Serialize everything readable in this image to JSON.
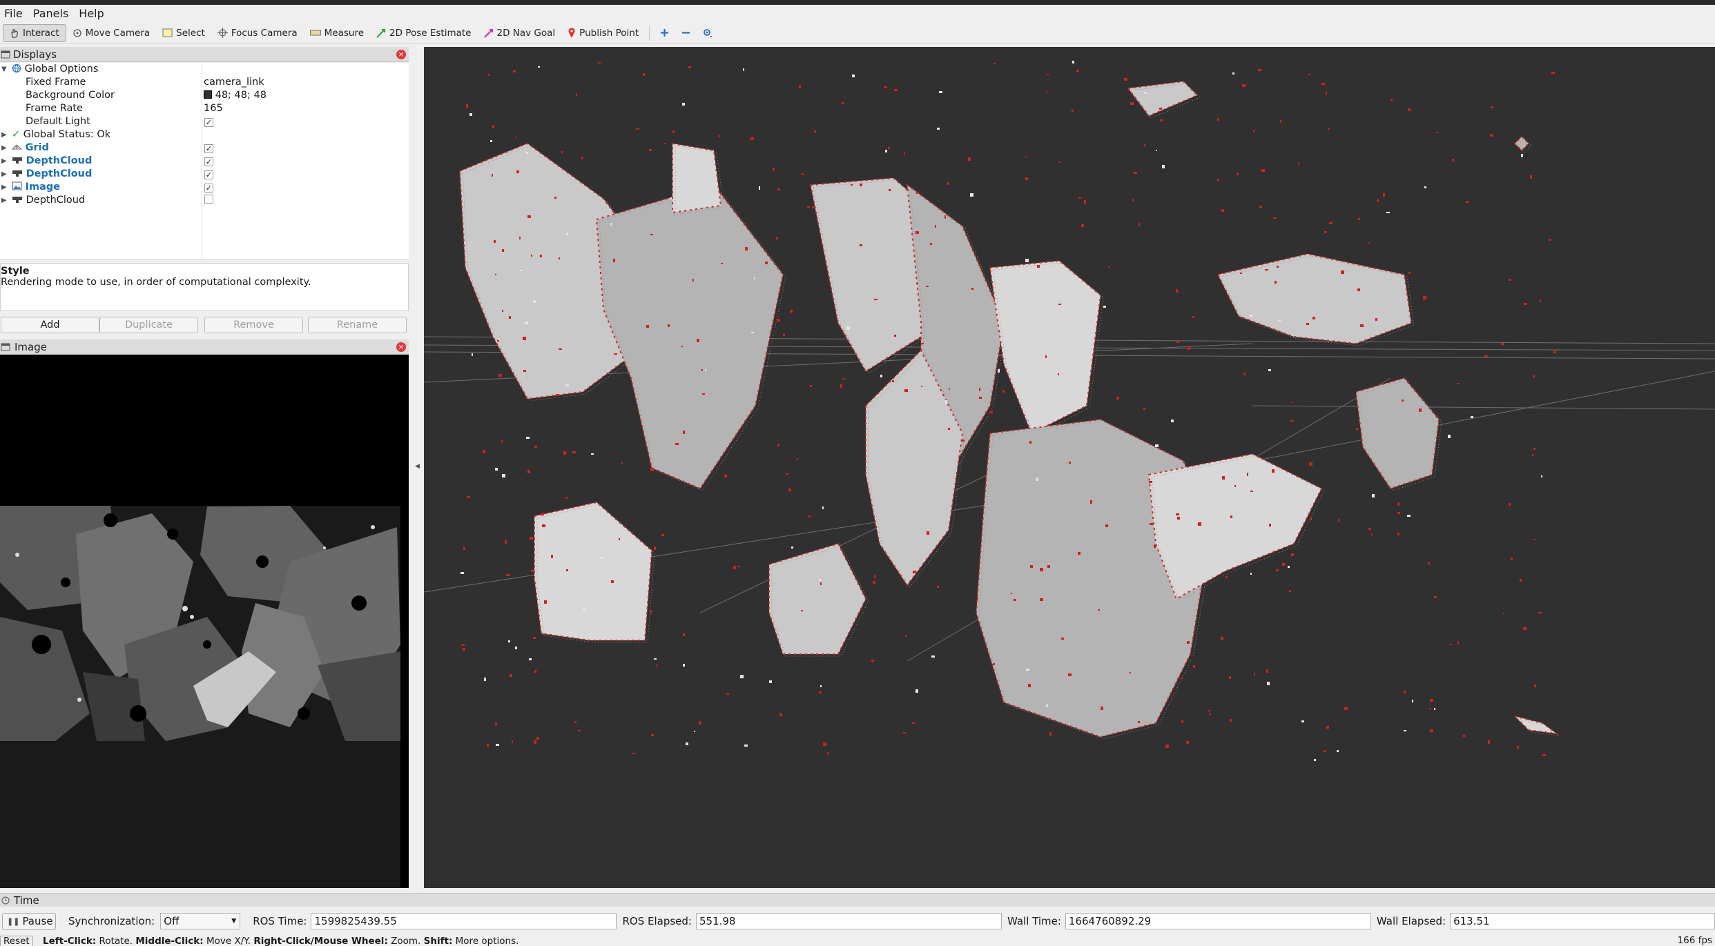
{
  "menu": {
    "file": "File",
    "panels": "Panels",
    "help": "Help"
  },
  "toolbar": {
    "interact": "Interact",
    "move_camera": "Move Camera",
    "select": "Select",
    "focus_camera": "Focus Camera",
    "measure": "Measure",
    "pose_estimate": "2D Pose Estimate",
    "nav_goal": "2D Nav Goal",
    "publish_point": "Publish Point"
  },
  "displays": {
    "title": "Displays",
    "global_options": "Global Options",
    "fixed_frame_label": "Fixed Frame",
    "fixed_frame_value": "camera_link",
    "background_color_label": "Background Color",
    "background_color_value": "48; 48; 48",
    "frame_rate_label": "Frame Rate",
    "frame_rate_value": "165",
    "default_light_label": "Default Light",
    "global_status": "Global Status: Ok",
    "items": [
      {
        "label": "Grid",
        "checked": true
      },
      {
        "label": "DepthCloud",
        "checked": true
      },
      {
        "label": "DepthCloud",
        "checked": true
      },
      {
        "label": "Image",
        "checked": true
      },
      {
        "label": "DepthCloud",
        "checked": false
      }
    ]
  },
  "description": {
    "title": "Style",
    "text": "Rendering mode to use, in order of computational complexity."
  },
  "buttons": {
    "add": "Add",
    "duplicate": "Duplicate",
    "remove": "Remove",
    "rename": "Rename"
  },
  "image_panel": {
    "title": "Image"
  },
  "time": {
    "title": "Time",
    "pause": "Pause",
    "sync_label": "Synchronization:",
    "sync_value": "Off",
    "ros_time_label": "ROS Time:",
    "ros_time": "1599825439.55",
    "ros_elapsed_label": "ROS Elapsed:",
    "ros_elapsed": "551.98",
    "wall_time_label": "Wall Time:",
    "wall_time": "1664760892.29",
    "wall_elapsed_label": "Wall Elapsed:",
    "wall_elapsed": "613.51"
  },
  "status": {
    "reset": "Reset",
    "left_click": "Left-Click:",
    "rotate": "Rotate.",
    "middle_click": "Middle-Click:",
    "move": "Move X/Y.",
    "right_click": "Right-Click/Mouse Wheel:",
    "zoom": "Zoom.",
    "shift": "Shift:",
    "more": "More options.",
    "fps": "166 fps"
  },
  "colors": {
    "view_bg": "#303030",
    "accent_blue": "#1d6fb8",
    "close_red": "#e0383a",
    "point_red": "#d42020"
  }
}
